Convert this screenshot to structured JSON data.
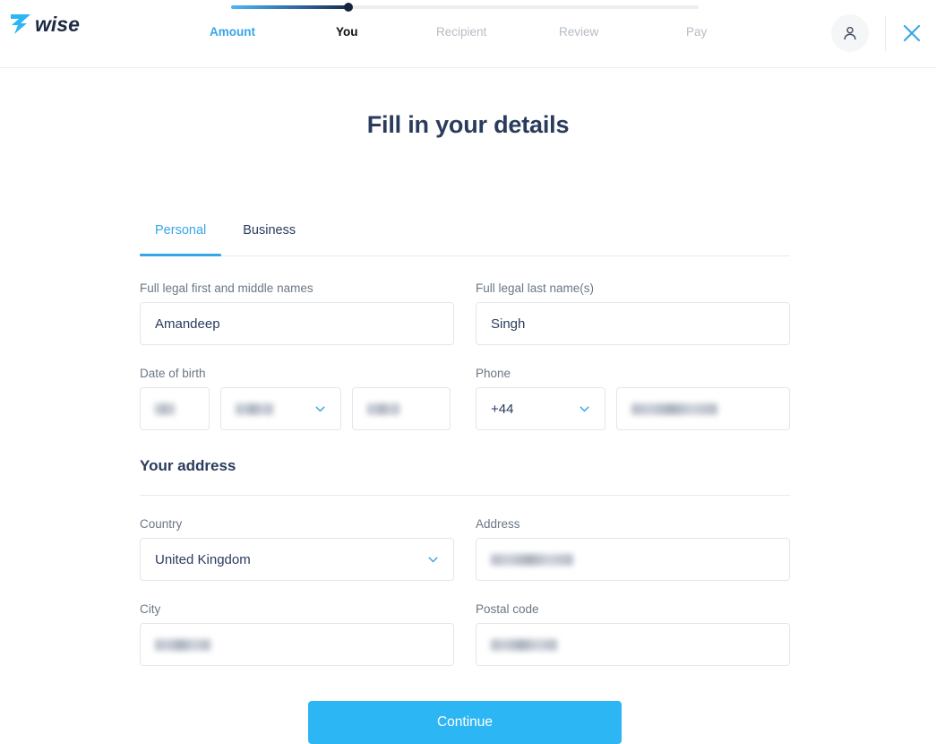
{
  "brand": {
    "name": "wise",
    "logo_mark": "wise-arrow-icon",
    "accent_blue": "#37a6e6",
    "button_blue": "#2cb6f3",
    "navy": "#2a3b5c",
    "dark_dot": "#17233d"
  },
  "header": {
    "avatar_icon": "person-icon",
    "close_icon": "close-icon",
    "progress": {
      "percent": 25,
      "fill_start_color": "#4ab8f0",
      "fill_end_color": "#1a2b4a",
      "track_color": "#eceef0"
    },
    "steps": [
      {
        "label": "Amount",
        "state": "done"
      },
      {
        "label": "You",
        "state": "active"
      },
      {
        "label": "Recipient",
        "state": "upcoming"
      },
      {
        "label": "Review",
        "state": "upcoming"
      },
      {
        "label": "Pay",
        "state": "upcoming"
      }
    ]
  },
  "main": {
    "title": "Fill in your details",
    "tabs": [
      {
        "label": "Personal",
        "active": true
      },
      {
        "label": "Business",
        "active": false
      }
    ],
    "fields": {
      "first_name": {
        "label": "Full legal first and middle names",
        "value": "Amandeep"
      },
      "last_name": {
        "label": "Full legal last name(s)",
        "value": "Singh"
      },
      "dob": {
        "label": "Date of birth",
        "day": {
          "value": "",
          "redacted": true
        },
        "month": {
          "value": "",
          "redacted": true,
          "chevron": "chevron-down-icon"
        },
        "year": {
          "value": "",
          "redacted": true
        }
      },
      "phone": {
        "label": "Phone",
        "country_code": "+44",
        "country_code_chevron": "chevron-down-icon",
        "number": {
          "value": "",
          "redacted": true
        }
      },
      "country": {
        "label": "Country",
        "value": "United Kingdom",
        "chevron": "chevron-down-icon"
      },
      "address": {
        "label": "Address",
        "value": "",
        "redacted": true
      },
      "city": {
        "label": "City",
        "value": "",
        "redacted": true
      },
      "postal_code": {
        "label": "Postal code",
        "value": "",
        "redacted": true
      }
    },
    "address_section_title": "Your address",
    "continue_label": "Continue"
  }
}
